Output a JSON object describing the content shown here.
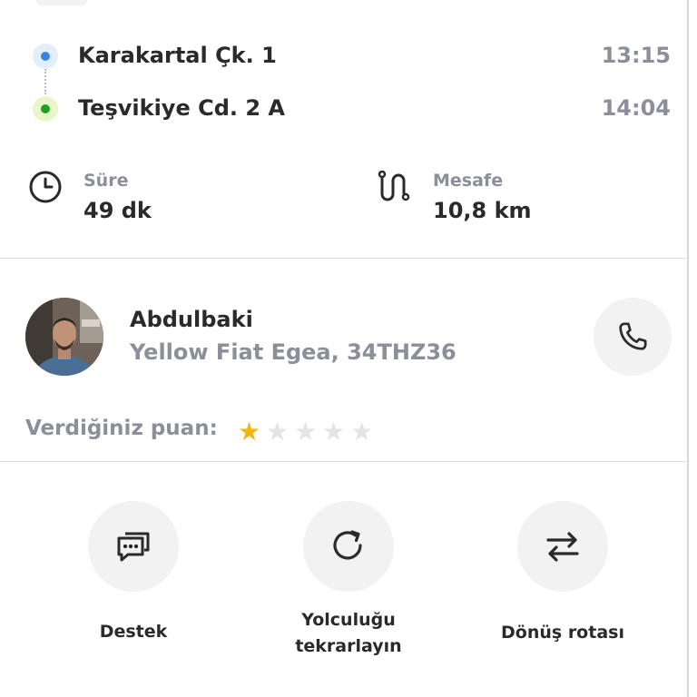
{
  "route": {
    "origin": {
      "name": "Karakartal Çk. 1",
      "time": "13:15",
      "dot_color": "#3b82e0"
    },
    "destination": {
      "name": "Teşvikiye Cd. 2 A",
      "time": "14:04",
      "dot_color": "#1ea21e"
    }
  },
  "stats": {
    "duration": {
      "label": "Süre",
      "value": "49 dk",
      "icon": "clock-icon"
    },
    "distance": {
      "label": "Mesafe",
      "value": "10,8 km",
      "icon": "route-icon"
    }
  },
  "driver": {
    "name": "Abdulbaki",
    "vehicle": "Yellow Fiat Egea, 34THZ36",
    "call_icon": "phone-icon"
  },
  "rating": {
    "label": "Verdiğiniz puan:",
    "value": 1,
    "max": 5,
    "active_color": "#f5b50f",
    "inactive_color": "#e3e4e7"
  },
  "actions": {
    "support": {
      "label": "Destek",
      "icon": "chat-support-icon"
    },
    "repeat": {
      "label_line1": "Yolculuğu",
      "label_line2": "tekrarlayın",
      "icon": "refresh-icon"
    },
    "return_route": {
      "label": "Dönüş rotası",
      "icon": "swap-arrows-icon"
    }
  }
}
